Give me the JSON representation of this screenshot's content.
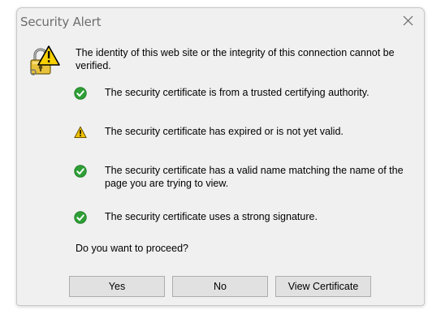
{
  "window": {
    "title": "Security Alert"
  },
  "dialog": {
    "intro": "The identity of this web site or the integrity of this connection cannot be verified.",
    "items": [
      {
        "icon": "check-icon",
        "status": "ok",
        "text": "The security certificate is from a trusted certifying authority."
      },
      {
        "icon": "warning-icon",
        "status": "warning",
        "text": "The security certificate has expired or is not yet valid."
      },
      {
        "icon": "check-icon",
        "status": "ok",
        "text": "The security certificate has a valid name matching the name of the page you are trying to view."
      },
      {
        "icon": "check-icon",
        "status": "ok",
        "text": "The security certificate uses a strong signature."
      }
    ],
    "question": "Do you want to proceed?"
  },
  "buttons": {
    "yes": "Yes",
    "no": "No",
    "view_certificate": "View Certificate"
  },
  "colors": {
    "ok": "#2e9f36",
    "warning": "#f0c000",
    "dialog_bg": "#f0f0f0"
  }
}
